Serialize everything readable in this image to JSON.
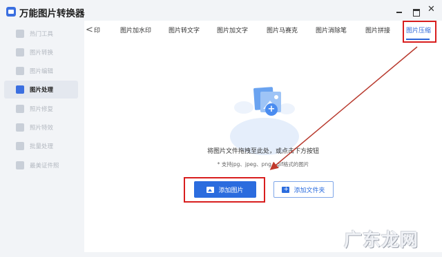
{
  "app": {
    "title": "万能图片转换器",
    "logo_icon": "app-logo-icon"
  },
  "window_controls": {
    "close_label": "✕"
  },
  "sidebar": {
    "items": [
      {
        "label": "热门工具",
        "icon": "fire-icon",
        "active": false
      },
      {
        "label": "图片转换",
        "icon": "convert-icon",
        "active": false
      },
      {
        "label": "图片编辑",
        "icon": "edit-icon",
        "active": false
      },
      {
        "label": "图片处理",
        "icon": "image-process-icon",
        "active": true
      },
      {
        "label": "照片修复",
        "icon": "repair-icon",
        "active": false
      },
      {
        "label": "照片特效",
        "icon": "effects-icon",
        "active": false
      },
      {
        "label": "批量处理",
        "icon": "batch-icon",
        "active": false
      },
      {
        "label": "最美证件照",
        "icon": "id-photo-icon",
        "active": false
      }
    ]
  },
  "tabs": {
    "prev_arrow": "<",
    "items": [
      {
        "label": "印",
        "active": false
      },
      {
        "label": "图片加水印",
        "active": false
      },
      {
        "label": "图片转文字",
        "active": false
      },
      {
        "label": "图片加文字",
        "active": false
      },
      {
        "label": "图片马赛克",
        "active": false
      },
      {
        "label": "图片消除笔",
        "active": false
      },
      {
        "label": "图片拼接",
        "active": false
      },
      {
        "label": "图片压缩",
        "active": true
      }
    ]
  },
  "upload": {
    "drop_text": "将图片文件拖拽至此处，或点击下方按钮",
    "hint_text": "* 支持jpg、jpeg、png、gif格式的图片",
    "add_picture_label": "添加图片",
    "add_folder_label": "添加文件夹"
  },
  "annotation": {
    "color": "#d81d1d"
  },
  "watermark": {
    "text": "广东龙网"
  },
  "colors": {
    "accent": "#2b6cde",
    "highlight_box": "#d81d1d"
  }
}
